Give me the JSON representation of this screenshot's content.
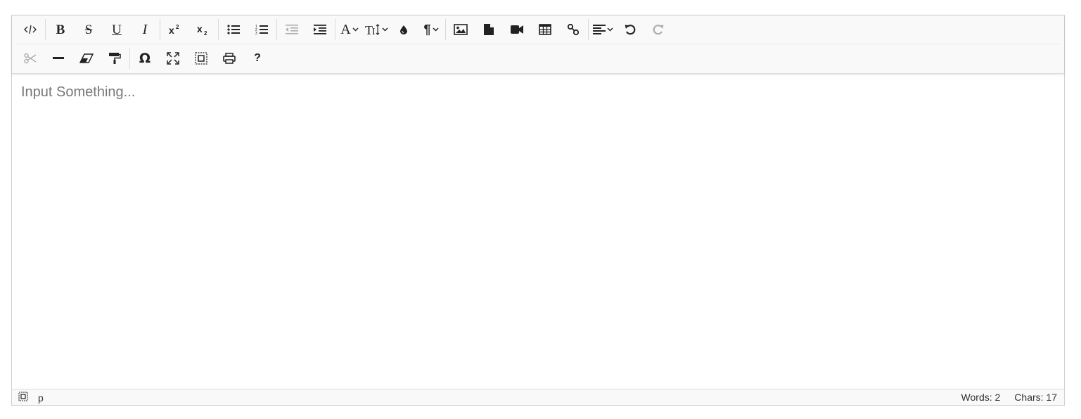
{
  "toolbar": {
    "row1": [
      {
        "name": "source-code-button",
        "icon": "code-icon"
      },
      {
        "sep": true
      },
      {
        "name": "bold-button",
        "icon": "bold-icon",
        "glyph": "B"
      },
      {
        "name": "strikethrough-button",
        "icon": "strikethrough-icon",
        "glyph": "S"
      },
      {
        "name": "underline-button",
        "icon": "underline-icon",
        "glyph": "U"
      },
      {
        "name": "italic-button",
        "icon": "italic-icon",
        "glyph": "I"
      },
      {
        "sep": true
      },
      {
        "name": "superscript-button",
        "icon": "superscript-icon"
      },
      {
        "name": "subscript-button",
        "icon": "subscript-icon"
      },
      {
        "sep": true
      },
      {
        "name": "unordered-list-button",
        "icon": "bullet-list-icon"
      },
      {
        "name": "ordered-list-button",
        "icon": "numbered-list-icon"
      },
      {
        "sep": true
      },
      {
        "name": "outdent-button",
        "icon": "outdent-icon",
        "disabled": true
      },
      {
        "name": "indent-button",
        "icon": "indent-icon"
      },
      {
        "sep": true
      },
      {
        "name": "font-family-dropdown",
        "icon": "font-icon",
        "dropdown": true
      },
      {
        "name": "font-size-dropdown",
        "icon": "font-size-icon",
        "dropdown": true
      },
      {
        "name": "text-color-button",
        "icon": "droplet-icon"
      },
      {
        "name": "paragraph-dropdown",
        "icon": "pilcrow-icon",
        "dropdown": true
      },
      {
        "sep": true
      },
      {
        "name": "insert-image-button",
        "icon": "image-icon"
      },
      {
        "name": "insert-file-button",
        "icon": "file-icon"
      },
      {
        "name": "insert-video-button",
        "icon": "video-icon"
      },
      {
        "name": "insert-table-button",
        "icon": "table-icon"
      },
      {
        "name": "insert-link-button",
        "icon": "link-icon"
      },
      {
        "sep": true
      },
      {
        "name": "align-dropdown",
        "icon": "align-left-icon",
        "dropdown": true
      },
      {
        "name": "undo-button",
        "icon": "undo-icon"
      },
      {
        "name": "redo-button",
        "icon": "redo-icon",
        "disabled": true
      }
    ],
    "row2": [
      {
        "name": "cut-button",
        "icon": "scissors-icon",
        "disabled": true
      },
      {
        "name": "horizontal-rule-button",
        "icon": "hr-icon"
      },
      {
        "name": "eraser-button",
        "icon": "eraser-icon"
      },
      {
        "name": "format-painter-button",
        "icon": "paint-roller-icon"
      },
      {
        "sep": true
      },
      {
        "name": "special-characters-button",
        "icon": "omega-icon",
        "glyph": "Ω"
      },
      {
        "name": "fullscreen-button",
        "icon": "expand-icon"
      },
      {
        "name": "select-all-button",
        "icon": "select-all-icon"
      },
      {
        "name": "print-button",
        "icon": "print-icon"
      },
      {
        "name": "help-button",
        "icon": "help-icon",
        "glyph": "?"
      }
    ]
  },
  "content": {
    "placeholder": "Input Something..."
  },
  "status": {
    "path_element": "p",
    "words": "Words: 2",
    "chars": "Chars: 17"
  },
  "colors": {
    "toolbar_bg": "#f9f9f9",
    "icon": "#222222",
    "border": "#cfcfcf"
  }
}
